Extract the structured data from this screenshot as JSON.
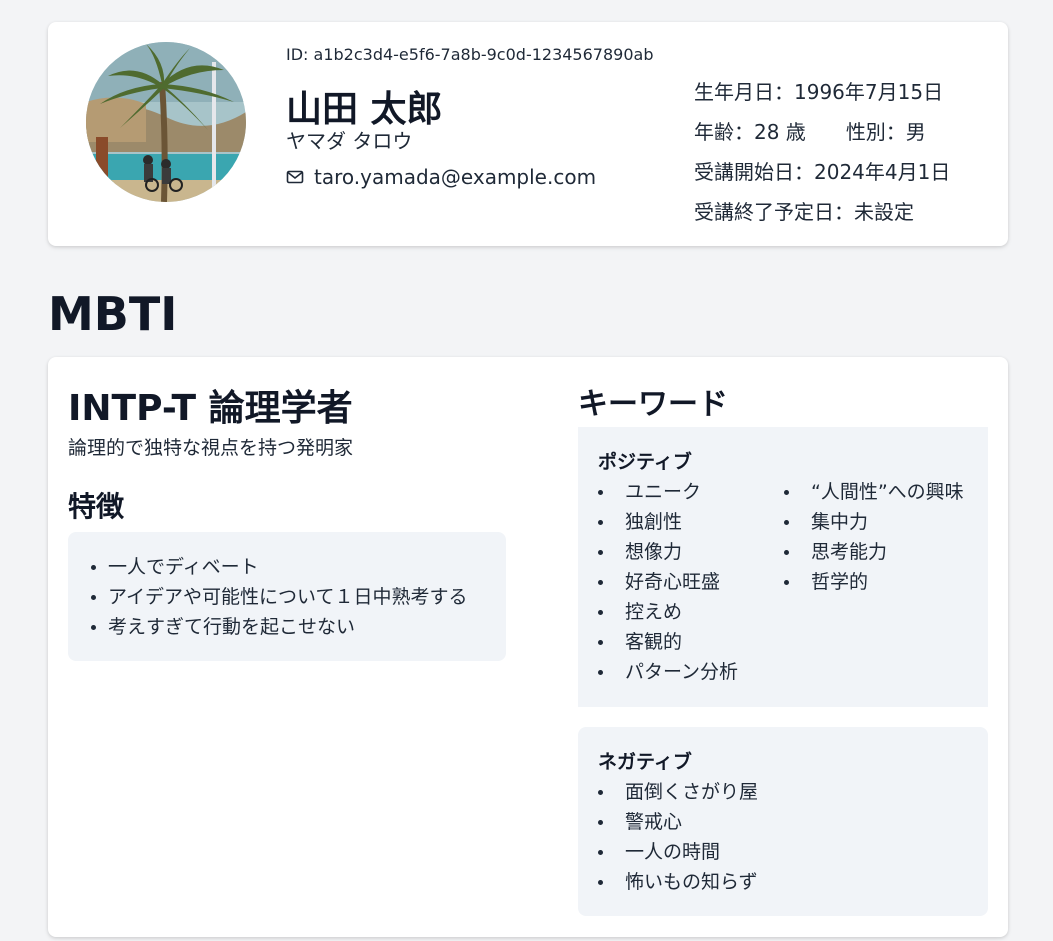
{
  "profile": {
    "id": "ID: a1b2c3d4-e5f6-7a8b-9c0d-1234567890ab",
    "name": "山田 太郎",
    "kana": "ヤマダ タロウ",
    "email": "taro.yamada@example.com",
    "email_icon": "mail-icon",
    "birthday": "生年月日：1996年7月15日",
    "age": "年齢：28 歳",
    "gender": "性別：男",
    "start_date": "受講開始日：2024年4月1日",
    "end_date": "受講終了予定日：未設定"
  },
  "mbti": {
    "section_title": "MBTI",
    "type_title": "INTP-T  論理学者",
    "subtitle": "論理的で独特な視点を持つ発明家",
    "features_title": "特徴",
    "features": [
      "一人でディベート",
      "アイデアや可能性について１日中熟考する",
      "考えすぎて行動を起こせない"
    ],
    "keywords_title": "キーワード",
    "positive_label": "ポジティブ",
    "positive_col1": [
      "ユニーク",
      "独創性",
      "想像力",
      "好奇心旺盛",
      "控えめ",
      "客観的",
      "パターン分析"
    ],
    "positive_col2": [
      "“人間性”への興味",
      "集中力",
      "思考能力",
      "哲学的"
    ],
    "negative_label": "ネガティブ",
    "negative": [
      "面倒くさがり屋",
      "警戒心",
      "一人の時間",
      "怖いもの知らず"
    ]
  },
  "colors": {
    "page_bg": "#f3f4f6",
    "card_bg": "#ffffff",
    "panel_bg": "#f1f4f8",
    "text": "#111827"
  }
}
